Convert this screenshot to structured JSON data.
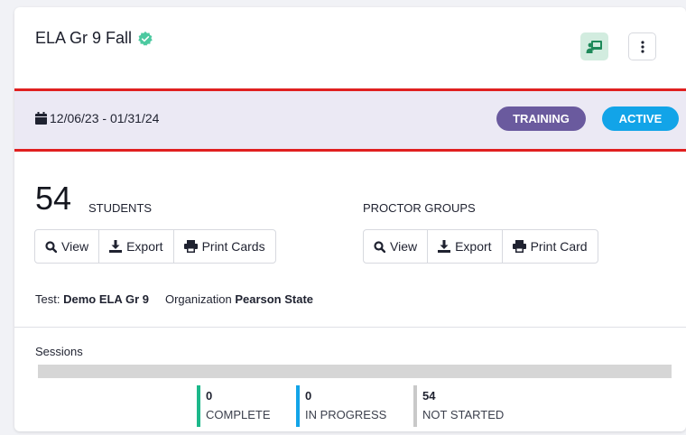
{
  "card": {
    "title": "ELA Gr 9 Fall",
    "date_range": "12/06/23 - 01/31/24",
    "badges": {
      "training": "TRAINING",
      "active": "ACTIVE"
    }
  },
  "students": {
    "count": "54",
    "label": "STUDENTS",
    "buttons": {
      "view": "View",
      "export": "Export",
      "print": "Print Cards"
    }
  },
  "proctor_groups": {
    "label": "PROCTOR GROUPS",
    "buttons": {
      "view": "View",
      "export": "Export",
      "print": "Print Card"
    }
  },
  "meta": {
    "test_label": "Test:",
    "test_value": "Demo ELA Gr 9",
    "org_label": "Organization",
    "org_value": "Pearson State"
  },
  "sessions": {
    "label": "Sessions",
    "stats": {
      "complete": {
        "value": "0",
        "label": "COMPLETE",
        "color": "#1cb88a"
      },
      "in_progress": {
        "value": "0",
        "label": "IN PROGRESS",
        "color": "#12a4e8"
      },
      "not_started": {
        "value": "54",
        "label": "NOT STARTED",
        "color": "#c9c9c9"
      }
    }
  },
  "colors": {
    "training_badge": "#6a5a9e",
    "active_badge": "#12a4e8",
    "date_bar_bg": "#ebe9f4",
    "highlight_border": "#e02020",
    "verified": "#4cc9a0",
    "classroom_icon": "#1e8a5a"
  },
  "icons": [
    "verified-check-icon",
    "classroom-icon",
    "more-vertical-icon",
    "calendar-icon",
    "search-icon",
    "download-icon",
    "print-icon"
  ]
}
